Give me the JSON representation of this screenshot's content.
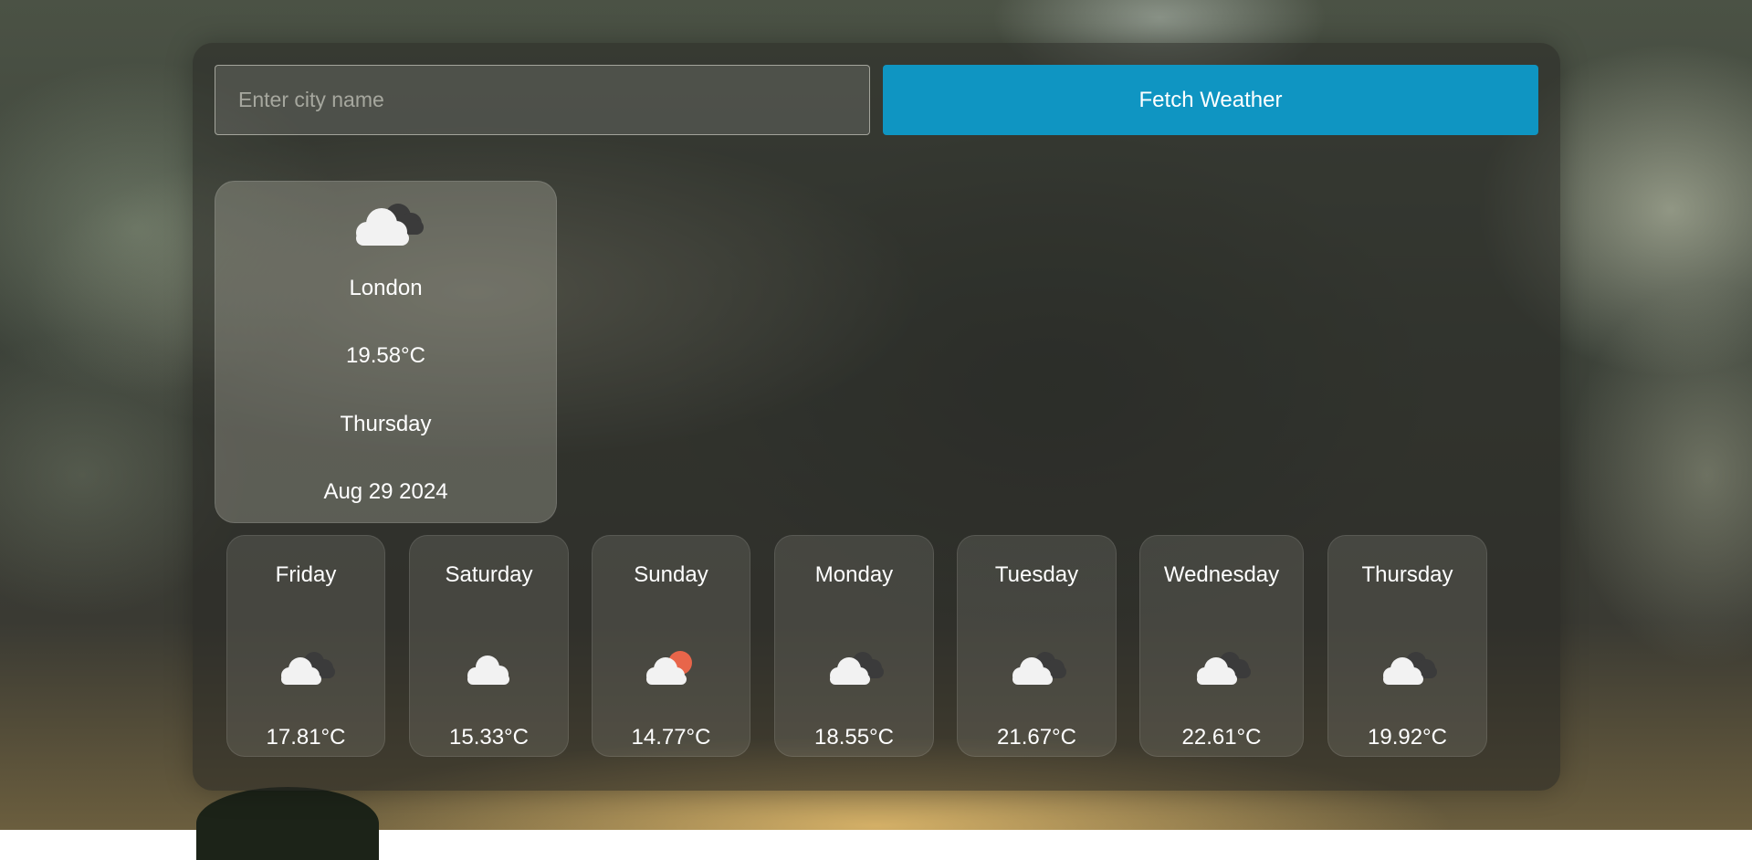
{
  "search": {
    "placeholder": "Enter city name",
    "value": ""
  },
  "fetch_button_label": "Fetch Weather",
  "colors": {
    "accent": "#0f95c2",
    "text": "#ffffff"
  },
  "current": {
    "icon": "cloudy-icon",
    "city": "London",
    "temperature": "19.58°C",
    "day": "Thursday",
    "date": "Aug 29 2024"
  },
  "forecast": [
    {
      "day": "Friday",
      "icon": "cloudy-icon",
      "temperature": "17.81°C"
    },
    {
      "day": "Saturday",
      "icon": "cloud-icon",
      "temperature": "15.33°C"
    },
    {
      "day": "Sunday",
      "icon": "partly-sunny-icon",
      "temperature": "14.77°C"
    },
    {
      "day": "Monday",
      "icon": "cloudy-icon",
      "temperature": "18.55°C"
    },
    {
      "day": "Tuesday",
      "icon": "cloudy-icon",
      "temperature": "21.67°C"
    },
    {
      "day": "Wednesday",
      "icon": "cloudy-icon",
      "temperature": "22.61°C"
    },
    {
      "day": "Thursday",
      "icon": "cloudy-icon",
      "temperature": "19.92°C"
    }
  ]
}
